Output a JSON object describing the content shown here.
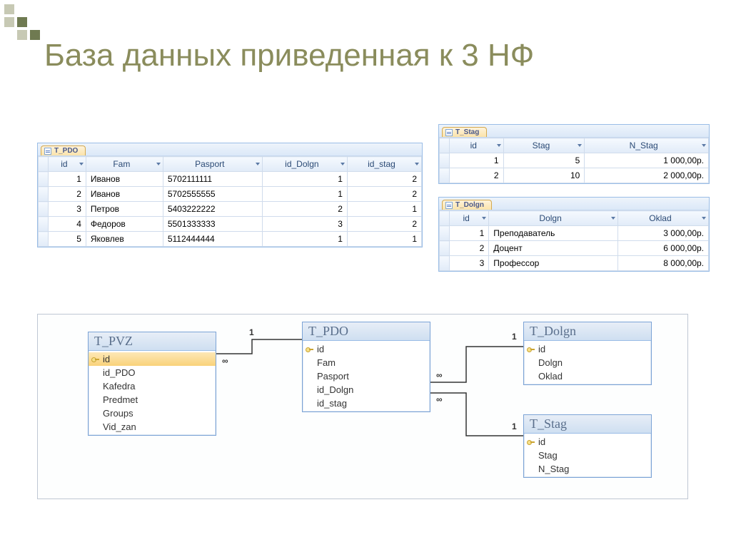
{
  "slide": {
    "title": "База данных приведенная к 3 НФ"
  },
  "tables": {
    "pdo": {
      "tab": "T_PDO",
      "headers": [
        "id",
        "Fam",
        "Pasport",
        "id_Dolgn",
        "id_stag"
      ],
      "rows": [
        {
          "id": "1",
          "fam": "Иванов",
          "pasport": "5702111111",
          "id_dolgn": "1",
          "id_stag": "2"
        },
        {
          "id": "2",
          "fam": "Иванов",
          "pasport": "5702555555",
          "id_dolgn": "1",
          "id_stag": "2"
        },
        {
          "id": "3",
          "fam": "Петров",
          "pasport": "5403222222",
          "id_dolgn": "2",
          "id_stag": "1"
        },
        {
          "id": "4",
          "fam": "Федоров",
          "pasport": "5501333333",
          "id_dolgn": "3",
          "id_stag": "2"
        },
        {
          "id": "5",
          "fam": "Яковлев",
          "pasport": "5112444444",
          "id_dolgn": "1",
          "id_stag": "1"
        }
      ]
    },
    "stag": {
      "tab": "T_Stag",
      "headers": [
        "id",
        "Stag",
        "N_Stag"
      ],
      "rows": [
        {
          "id": "1",
          "stag": "5",
          "n_stag": "1 000,00р."
        },
        {
          "id": "2",
          "stag": "10",
          "n_stag": "2 000,00р."
        }
      ]
    },
    "dolgn": {
      "tab": "T_Dolgn",
      "headers": [
        "id",
        "Dolgn",
        "Oklad"
      ],
      "rows": [
        {
          "id": "1",
          "dolgn": "Преподаватель",
          "oklad": "3 000,00р."
        },
        {
          "id": "2",
          "dolgn": "Доцент",
          "oklad": "6 000,00р."
        },
        {
          "id": "3",
          "dolgn": "Профессор",
          "oklad": "8 000,00р."
        }
      ]
    }
  },
  "diagram": {
    "pvz": {
      "title": "T_PVZ",
      "fields": [
        "id",
        "id_PDO",
        "Kafedra",
        "Predmet",
        "Groups",
        "Vid_zan"
      ],
      "pk": 0
    },
    "pdo": {
      "title": "T_PDO",
      "fields": [
        "id",
        "Fam",
        "Pasport",
        "id_Dolgn",
        "id_stag"
      ],
      "pk": 0
    },
    "dolgn": {
      "title": "T_Dolgn",
      "fields": [
        "id",
        "Dolgn",
        "Oklad"
      ],
      "pk": 0
    },
    "stag": {
      "title": "T_Stag",
      "fields": [
        "id",
        "Stag",
        "N_Stag"
      ],
      "pk": 0
    },
    "cardinality": {
      "one": "1",
      "many": "∞"
    }
  }
}
